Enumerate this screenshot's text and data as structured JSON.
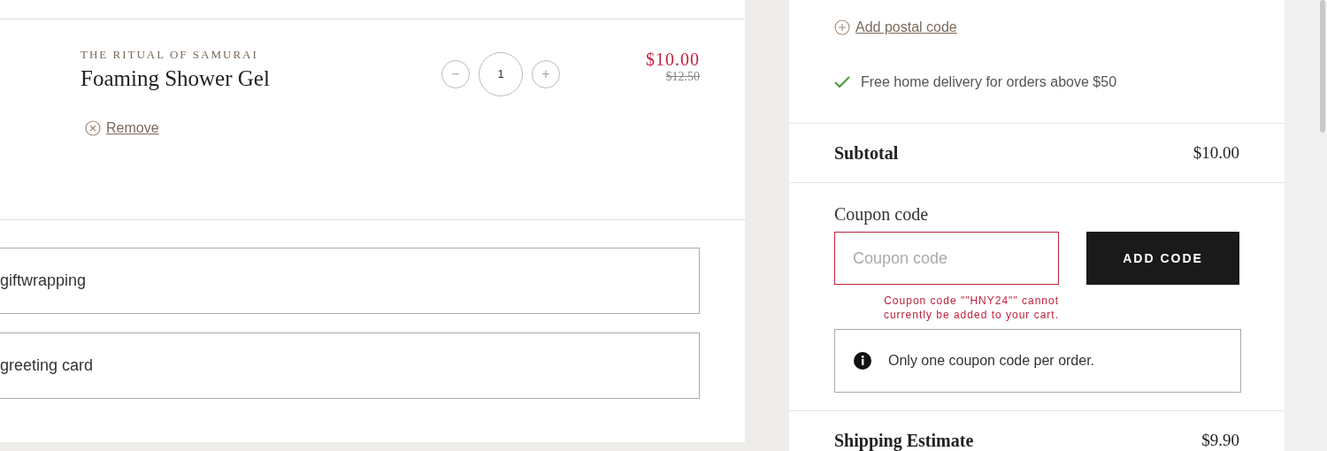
{
  "cart_item": {
    "brand": "THE RITUAL OF SAMURAI",
    "name": "Foaming Shower Gel",
    "quantity": "1",
    "decrease": "−",
    "increase": "+",
    "price": "$10.00",
    "original_price": "$12.50",
    "remove": "Remove"
  },
  "options": [
    {
      "label": "giftwrapping"
    },
    {
      "label": "greeting card"
    }
  ],
  "summary": {
    "add_postal_code": "Add postal code",
    "delivery_note": "Free home delivery for orders above $50",
    "subtotal_label": "Subtotal",
    "subtotal": "$10.00",
    "coupon": {
      "label": "Coupon code",
      "placeholder": "Coupon code",
      "invalid": true,
      "error": "Coupon code \"\"HNY24\"\" cannot currently be added to your cart.",
      "button": "ADD CODE"
    },
    "info": "Only one coupon code per order.",
    "shipping_label": "Shipping Estimate",
    "shipping": "$9.90"
  }
}
